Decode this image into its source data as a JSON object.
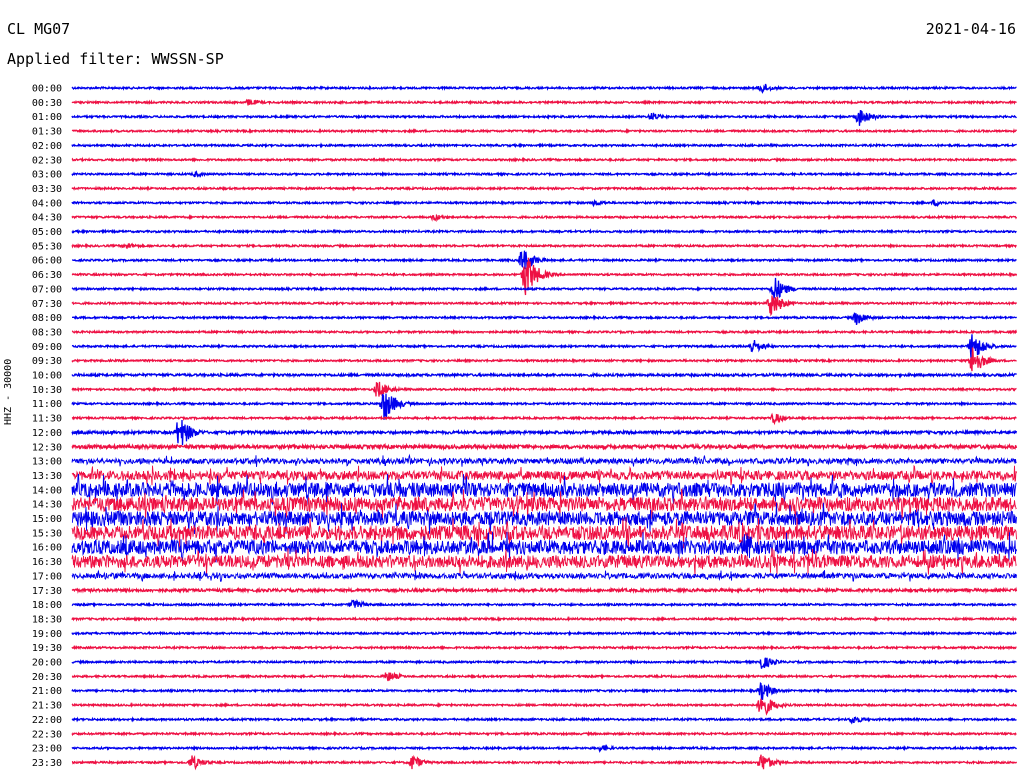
{
  "header": {
    "station": "CL MG07",
    "date": "2021-04-16",
    "filter": "Applied filter: WWSSN-SP"
  },
  "axis": {
    "ylabel": "HHZ - 30000"
  },
  "colors": {
    "trace_a": "#0000ee",
    "trace_b": "#ee1144"
  },
  "chart_data": {
    "type": "line",
    "title": "CL MG07",
    "subtitle": "Applied filter: WWSSN-SP",
    "ylabel": "HHZ - 30000",
    "y_tick_labels": [
      "00:00",
      "00:30",
      "01:00",
      "01:30",
      "02:00",
      "02:30",
      "03:00",
      "03:30",
      "04:00",
      "04:30",
      "05:00",
      "05:30",
      "06:00",
      "06:30",
      "07:00",
      "07:30",
      "08:00",
      "08:30",
      "09:00",
      "09:30",
      "10:00",
      "10:30",
      "11:00",
      "11:30",
      "12:00",
      "12:30",
      "13:00",
      "13:30",
      "14:00",
      "14:30",
      "15:00",
      "15:30",
      "16:00",
      "16:30",
      "17:00",
      "17:30",
      "18:00",
      "18:30",
      "19:00",
      "19:30",
      "20:00",
      "20:30",
      "21:00",
      "21:30",
      "22:00",
      "22:30",
      "23:00",
      "23:30"
    ],
    "x_unit": "minutes into 30-minute trace",
    "x_range": [
      0,
      30
    ],
    "series_colors": [
      "#0000ee",
      "#ee1144"
    ],
    "noise_level": [
      1,
      1,
      1,
      1,
      1,
      1,
      1,
      1,
      1,
      1,
      1,
      1,
      1,
      1,
      1,
      1,
      1,
      1,
      1,
      1,
      1.3,
      1,
      1,
      1,
      1.5,
      2,
      3,
      5,
      8,
      8,
      8,
      8,
      8,
      7,
      3,
      1.5,
      1,
      1,
      1,
      1,
      1,
      1,
      1,
      1,
      1,
      1,
      1,
      1
    ],
    "events": [
      {
        "trace": "00:00",
        "minute": 21.9,
        "amplitude": 6
      },
      {
        "trace": "00:30",
        "minute": 5.6,
        "amplitude": 4
      },
      {
        "trace": "01:00",
        "minute": 18.4,
        "amplitude": 5
      },
      {
        "trace": "01:00",
        "minute": 25.0,
        "amplitude": 10
      },
      {
        "trace": "03:00",
        "minute": 3.9,
        "amplitude": 3
      },
      {
        "trace": "04:00",
        "minute": 16.6,
        "amplitude": 4
      },
      {
        "trace": "04:00",
        "minute": 27.4,
        "amplitude": 4
      },
      {
        "trace": "04:30",
        "minute": 11.5,
        "amplitude": 4
      },
      {
        "trace": "05:30",
        "minute": 1.7,
        "amplitude": 4
      },
      {
        "trace": "06:00",
        "minute": 14.3,
        "amplitude": 14
      },
      {
        "trace": "06:30",
        "minute": 14.4,
        "amplitude": 24
      },
      {
        "trace": "07:00",
        "minute": 22.3,
        "amplitude": 14
      },
      {
        "trace": "07:30",
        "minute": 22.2,
        "amplitude": 14
      },
      {
        "trace": "08:00",
        "minute": 24.9,
        "amplitude": 8
      },
      {
        "trace": "09:00",
        "minute": 21.6,
        "amplitude": 8
      },
      {
        "trace": "09:00",
        "minute": 28.6,
        "amplitude": 16
      },
      {
        "trace": "09:30",
        "minute": 28.6,
        "amplitude": 16
      },
      {
        "trace": "10:30",
        "minute": 9.7,
        "amplitude": 10
      },
      {
        "trace": "11:00",
        "minute": 9.9,
        "amplitude": 18
      },
      {
        "trace": "11:30",
        "minute": 22.3,
        "amplitude": 6
      },
      {
        "trace": "12:00",
        "minute": 3.4,
        "amplitude": 18
      },
      {
        "trace": "15:30",
        "minute": 21.2,
        "amplitude": 14
      },
      {
        "trace": "16:00",
        "minute": 21.4,
        "amplitude": 22
      },
      {
        "trace": "18:00",
        "minute": 8.9,
        "amplitude": 6
      },
      {
        "trace": "20:00",
        "minute": 21.9,
        "amplitude": 8
      },
      {
        "trace": "20:30",
        "minute": 10.0,
        "amplitude": 6
      },
      {
        "trace": "21:00",
        "minute": 21.9,
        "amplitude": 10
      },
      {
        "trace": "21:30",
        "minute": 21.9,
        "amplitude": 14
      },
      {
        "trace": "22:00",
        "minute": 24.8,
        "amplitude": 5
      },
      {
        "trace": "23:00",
        "minute": 16.8,
        "amplitude": 4
      },
      {
        "trace": "23:30",
        "minute": 3.8,
        "amplitude": 8
      },
      {
        "trace": "23:30",
        "minute": 10.8,
        "amplitude": 8
      },
      {
        "trace": "23:30",
        "minute": 21.9,
        "amplitude": 10
      }
    ]
  }
}
